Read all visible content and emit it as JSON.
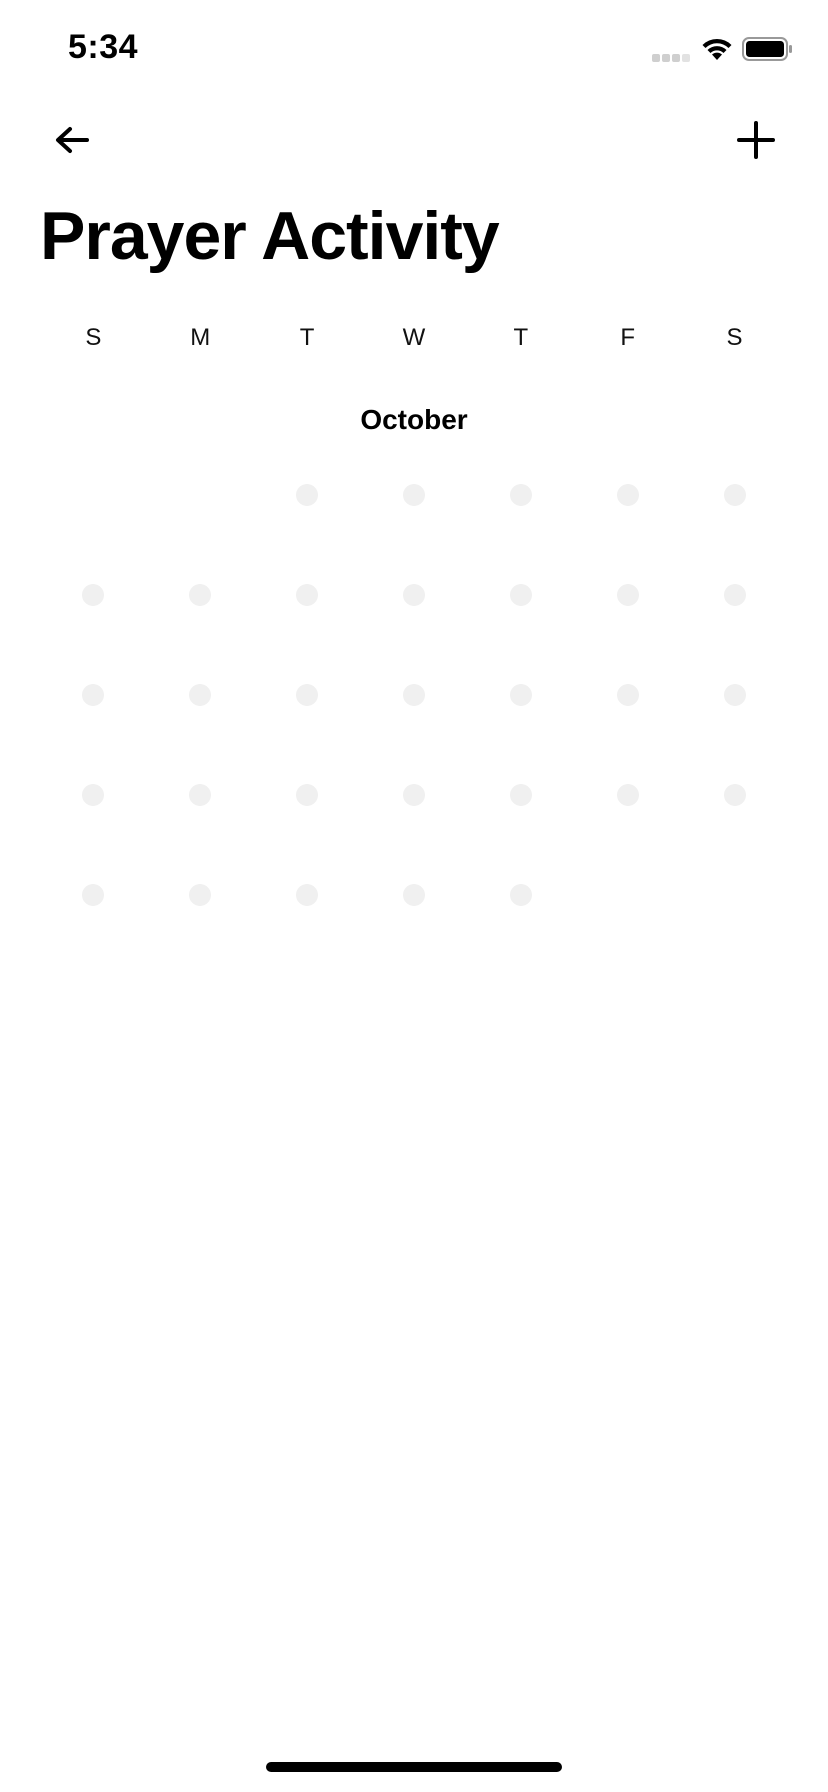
{
  "status_bar": {
    "time": "5:34",
    "signal_icon": "cellular-signal-icon",
    "wifi_icon": "wifi-icon",
    "battery_icon": "battery-icon"
  },
  "nav": {
    "back_icon": "arrow-left-icon",
    "add_icon": "plus-icon"
  },
  "page": {
    "title": "Prayer Activity"
  },
  "calendar": {
    "weekdays": [
      "S",
      "M",
      "T",
      "W",
      "T",
      "F",
      "S"
    ],
    "month": "October",
    "leading_empty_days": 2,
    "day_count": 31,
    "dot_color": "#f0f0f0"
  },
  "colors": {
    "background": "#ffffff",
    "text": "#000000",
    "dot": "#f0f0f0"
  }
}
